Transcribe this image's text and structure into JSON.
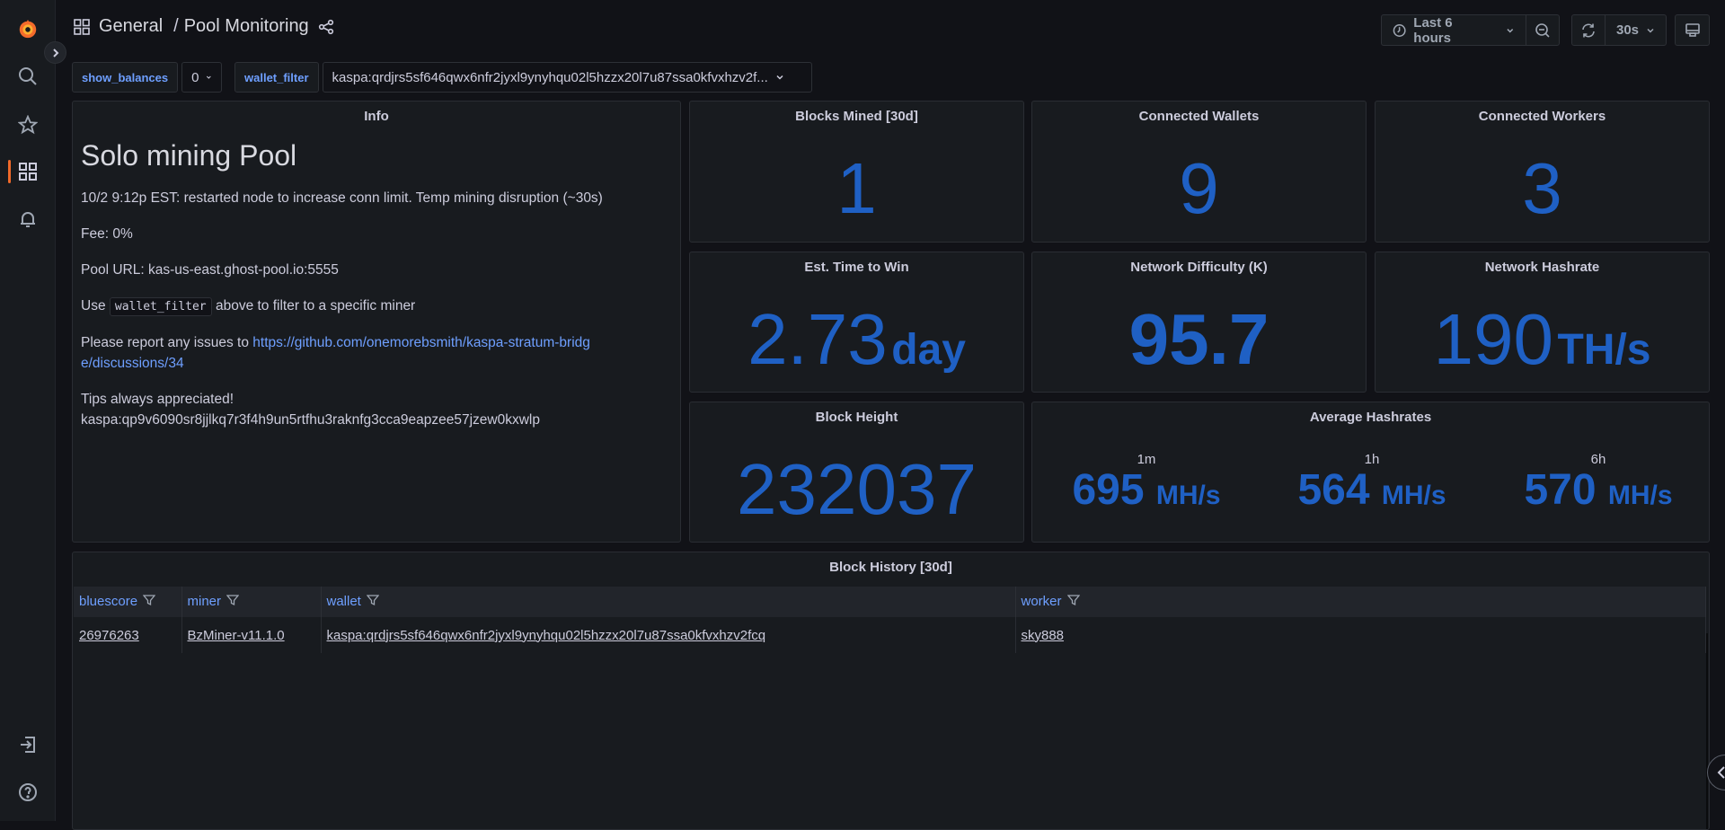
{
  "nav": {
    "breadcrumb_folder": "General",
    "breadcrumb_sep": "/",
    "dashboard_title": "Pool Monitoring",
    "icons": [
      "grafana-logo",
      "search-icon",
      "star-icon",
      "dashboards-icon",
      "bell-icon",
      "sign-in-icon",
      "help-icon"
    ]
  },
  "toolbar": {
    "time_range": "Last 6 hours",
    "refresh_interval": "30s"
  },
  "variables": {
    "show_balances_label": "show_balances",
    "show_balances_value": "0",
    "wallet_filter_label": "wallet_filter",
    "wallet_filter_value": "kaspa:qrdjrs5sf646qwx6nfr2jyxl9ynyhqu02l5hzzx20l7u87ssa0kfvxhzv2f..."
  },
  "info": {
    "title": "Info",
    "heading": "Solo mining Pool",
    "notice": "10/2 9:12p EST: restarted node to increase conn limit. Temp mining disruption (~30s)",
    "fee": "Fee: 0%",
    "pool_url": "Pool URL: kas-us-east.ghost-pool.io:5555",
    "use_prefix": "Use",
    "use_code": "wallet_filter",
    "use_suffix": "above to filter to a specific miner",
    "report_prefix": "Please report any issues to",
    "report_link": "https://github.com/onemorebsmith/kaspa-stratum-bridge/discussions/34",
    "tips_label": "Tips always appreciated!",
    "tips_address": "kaspa:qp9v6090sr8jjlkq7r3f4h9un5rtfhu3raknfg3cca9eapzee57jzew0kxwlp"
  },
  "stats": {
    "blocks_mined": {
      "title": "Blocks Mined [30d]",
      "value": "1",
      "unit": ""
    },
    "connected_wallets": {
      "title": "Connected Wallets",
      "value": "9",
      "unit": ""
    },
    "connected_workers": {
      "title": "Connected Workers",
      "value": "3",
      "unit": ""
    },
    "est_time": {
      "title": "Est. Time to Win",
      "value": "2.73",
      "unit": "day"
    },
    "network_difficulty": {
      "title": "Network Difficulty (K)",
      "value": "95.7",
      "unit": ""
    },
    "network_hashrate": {
      "title": "Network Hashrate",
      "value": "190",
      "unit": "TH/s"
    },
    "block_height": {
      "title": "Block Height",
      "value": "232037",
      "unit": ""
    }
  },
  "average_hashrates": {
    "title": "Average Hashrates",
    "items": [
      {
        "label": "1m",
        "value": "695",
        "unit": "MH/s"
      },
      {
        "label": "1h",
        "value": "564",
        "unit": "MH/s"
      },
      {
        "label": "6h",
        "value": "570",
        "unit": "MH/s"
      }
    ]
  },
  "block_history": {
    "title": "Block History [30d]",
    "columns": [
      "bluescore",
      "miner",
      "wallet",
      "worker"
    ],
    "rows": [
      [
        "26976263",
        "BzMiner-v11.1.0",
        "kaspa:qrdjrs5sf646qwx6nfr2jyxl9ynyhqu02l5hzzx20l7u87ssa0kfvxhzv2fcq",
        "sky888"
      ]
    ]
  },
  "colors": {
    "accent_blue": "#1f60c4",
    "link_blue": "#6e9fff",
    "active_orange": "#f06a2a"
  }
}
